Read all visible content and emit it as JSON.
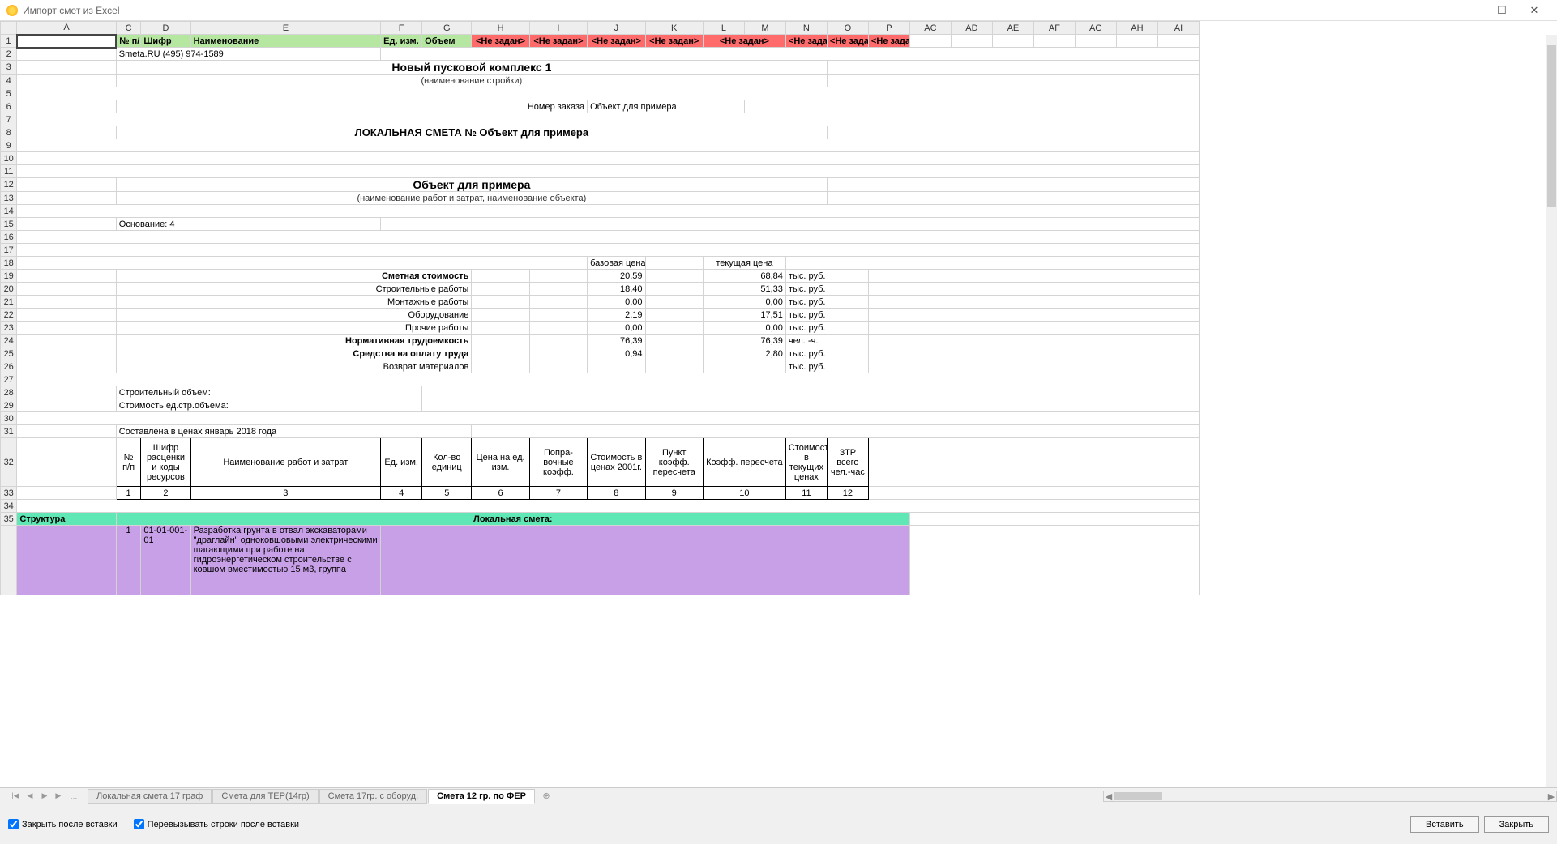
{
  "window": {
    "title": "Импорт смет из Excel"
  },
  "columns": [
    "A",
    "C",
    "D",
    "E",
    "F",
    "G",
    "H",
    "I",
    "J",
    "K",
    "L",
    "M",
    "N",
    "O",
    "P",
    "AC",
    "AD",
    "AE",
    "AF",
    "AG",
    "AH",
    "AI"
  ],
  "headers": {
    "c": "№ п/п",
    "d": "Шифр",
    "e": "Наименование",
    "f": "Ед. изм.",
    "g": "Объем",
    "notset": "<Не задан>"
  },
  "doc": {
    "company": "Smeta.RU  (495) 974-1589",
    "title1": "Новый пусковой комплекс 1",
    "subtitle1": "(наименование стройки)",
    "order_label": "Номер заказа",
    "order_value": "Объект для примера",
    "local_smeta": "ЛОКАЛЬНАЯ СМЕТА № Объект для примера",
    "object_title": "Объект для примера",
    "subtitle2": "(наименование работ и затрат, наименование объекта)",
    "basis": "Основание: 4",
    "base_price": "базовая цена",
    "current_price": "текущая цена",
    "cost_rows": [
      {
        "label": "Сметная стоимость",
        "b": "20,59",
        "c": "68,84",
        "u": "тыс. руб.",
        "bold": true
      },
      {
        "label": "Строительные работы",
        "b": "18,40",
        "c": "51,33",
        "u": "тыс. руб."
      },
      {
        "label": "Монтажные работы",
        "b": "0,00",
        "c": "0,00",
        "u": "тыс. руб."
      },
      {
        "label": "Оборудование",
        "b": "2,19",
        "c": "17,51",
        "u": "тыс. руб."
      },
      {
        "label": "Прочие работы",
        "b": "0,00",
        "c": "0,00",
        "u": "тыс. руб."
      },
      {
        "label": "Нормативная трудоемкость",
        "b": "76,39",
        "c": "76,39",
        "u": "чел. -ч.",
        "bold": true
      },
      {
        "label": "Средства на оплату труда",
        "b": "0,94",
        "c": "2,80",
        "u": "тыс. руб.",
        "bold": true
      },
      {
        "label": "Возврат материалов",
        "b": "",
        "c": "",
        "u": "тыс. руб."
      }
    ],
    "build_vol": "Строительный объем:",
    "build_cost": "Стоимость ед.стр.объема:",
    "prices_date": "Составлена в ценах январь 2018 года",
    "structure": "Структура",
    "local_smeta_section": "Локальная смета:",
    "item1_num": "1",
    "item1_code": "01-01-001-01",
    "item1_name": "Разработка грунта в отвал экскаваторами \"драглайн\" одноковшовыми электрическими шагающими при работе на гидроэнергетическом строительстве с ковшом вместимостью 15 м3, группа"
  },
  "inner_headers": {
    "h1": "№ п/п",
    "h2": "Шифр расценки и коды ресурсов",
    "h3": "Наименование работ и затрат",
    "h4": "Ед. изм.",
    "h5": "Кол-во единиц",
    "h6": "Цена на ед. изм.",
    "h7": "Попра-вочные коэфф.",
    "h8": "Стоимость в ценах 2001г.",
    "h9": "Пункт коэфф. пересчета",
    "h10": "Коэфф. пересчета",
    "h11": "Стоимость в текущих ценах",
    "h12": "ЗТР всего чел.-час"
  },
  "tabs": {
    "t1": "Локальная смета 17 граф",
    "t2": "Смета для ТЕР(14гр)",
    "t3": "Смета 17гр. с оборуд.",
    "t4": "Смета 12 гр. по ФЕР"
  },
  "footer": {
    "chk1": "Закрыть после вставки",
    "chk2": "Перевызывать строки после вставки",
    "insert": "Вставить",
    "close": "Закрыть"
  }
}
